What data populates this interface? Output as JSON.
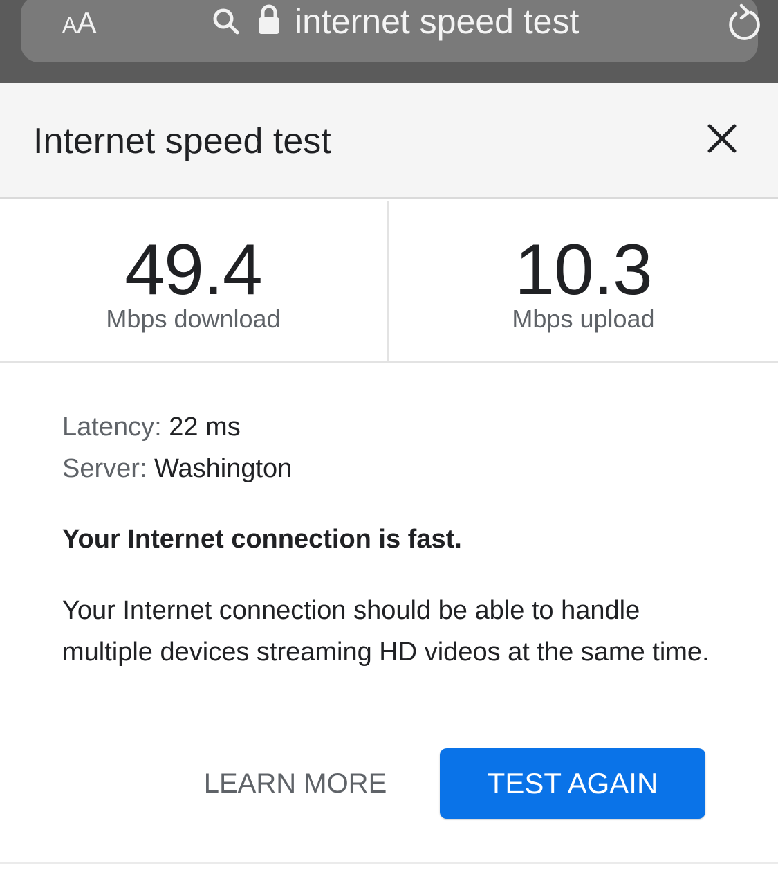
{
  "browser": {
    "text_size_small": "A",
    "text_size_large": "A",
    "url_text": "internet speed test",
    "icons": [
      "search-icon",
      "lock-icon",
      "reload-icon"
    ]
  },
  "panel": {
    "title": "Internet speed test",
    "close_icon": "close-icon"
  },
  "metrics": {
    "download": {
      "value": "49.4",
      "label": "Mbps download"
    },
    "upload": {
      "value": "10.3",
      "label": "Mbps upload"
    }
  },
  "details": {
    "latency_key": "Latency:",
    "latency_value": "22 ms",
    "server_key": "Server:",
    "server_value": "Washington"
  },
  "result": {
    "verdict": "Your Internet connection is fast.",
    "description": "Your Internet connection should be able to handle multiple devices streaming HD videos at the same time."
  },
  "actions": {
    "learn_more": "LEARN MORE",
    "test_again": "TEST AGAIN"
  },
  "colors": {
    "browser_bar": "#5b5b5b",
    "url_pill": "#7a7a7a",
    "accent_button": "#0a73e8",
    "secondary_text": "#5f6368"
  }
}
